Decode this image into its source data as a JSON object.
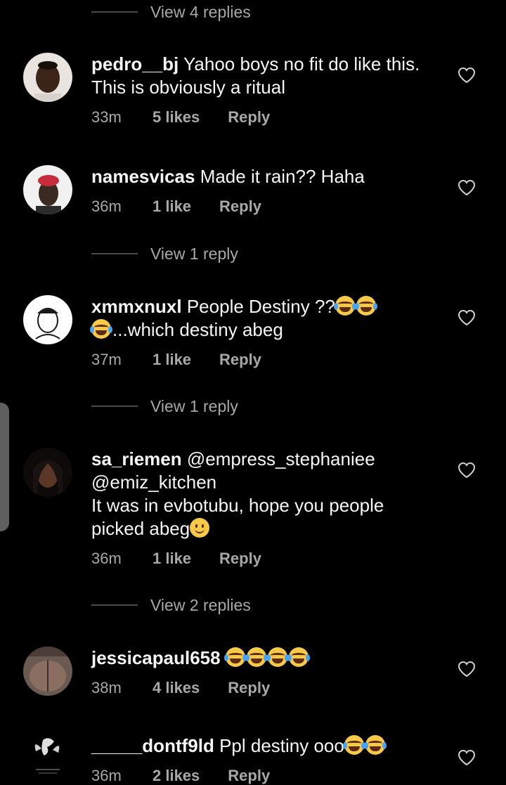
{
  "comments": [
    {
      "username": "pedro__bj",
      "lines": [
        "Yahoo boys no fit do like this.",
        "This is obviously a ritual"
      ],
      "time": "33m",
      "likes": "5 likes",
      "reply": "Reply"
    },
    {
      "username": "namesvicas",
      "lines": [
        "Made it rain?? Haha"
      ],
      "time": "36m",
      "likes": "1 like",
      "reply": "Reply",
      "view_replies": "View 1 reply"
    },
    {
      "username": "xmmxnuxl",
      "text_1": "People Destiny ??",
      "text_2": "...which destiny abeg",
      "time": "37m",
      "likes": "1 like",
      "reply": "Reply",
      "view_replies": "View 1 reply"
    },
    {
      "username": "sa_riemen",
      "mention_1": "@empress_stephaniee",
      "mention_2": "@emiz_kitchen",
      "line_3": "It was in evbotubu, hope you people",
      "line_4": "picked abeg",
      "time": "36m",
      "likes": "1 like",
      "reply": "Reply",
      "view_replies": "View 2 replies"
    },
    {
      "username": "jessicapaul658",
      "time": "38m",
      "likes": "4 likes",
      "reply": "Reply"
    },
    {
      "username": "_____dontf9ld",
      "text_1": "Ppl destiny ooo",
      "time": "36m",
      "likes": "2 likes",
      "reply": "Reply"
    }
  ],
  "top_view_replies": "View 4 replies",
  "emojis": {
    "laugh": "face-with-tears-of-joy-icon",
    "smile": "slightly-smiling-face-icon"
  },
  "colors": {
    "background": "#000000",
    "text_primary": "#f5f5f5",
    "text_secondary": "#a8a8a8",
    "divider": "#4a4a4a"
  }
}
